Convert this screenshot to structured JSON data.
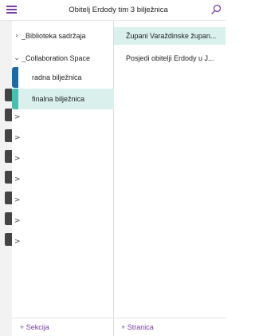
{
  "header": {
    "title": "Obitelj Erdody tim 3 bilježnica",
    "menu_icon": "hamburger-icon",
    "search_icon": "search-icon",
    "accent_color": "#7a3fa3"
  },
  "sections_panel": {
    "items": [
      {
        "label": "_Biblioteka sadržaja",
        "expanded": false
      },
      {
        "label": "_Collaboration Space",
        "expanded": true
      }
    ],
    "notebooks": [
      {
        "label": "radna bilježnica",
        "color": "#1f6aa5",
        "selected": false
      },
      {
        "label": "finalna bilježnica",
        "color": "#49bfb1",
        "selected": true
      }
    ],
    "collapsed_rows": [
      ">",
      ">",
      ">",
      ">",
      ">",
      ">",
      ">"
    ],
    "add_label": "+ Sekcija"
  },
  "pages_panel": {
    "pages": [
      {
        "label": "Župani Varaždinske župan...",
        "selected": true
      },
      {
        "label": "Posjedi obitelji Erdody u J...",
        "selected": false
      }
    ],
    "add_label": "+ Stranica"
  },
  "chevrons": {
    "collapsed": "›",
    "expanded": "⌄"
  }
}
